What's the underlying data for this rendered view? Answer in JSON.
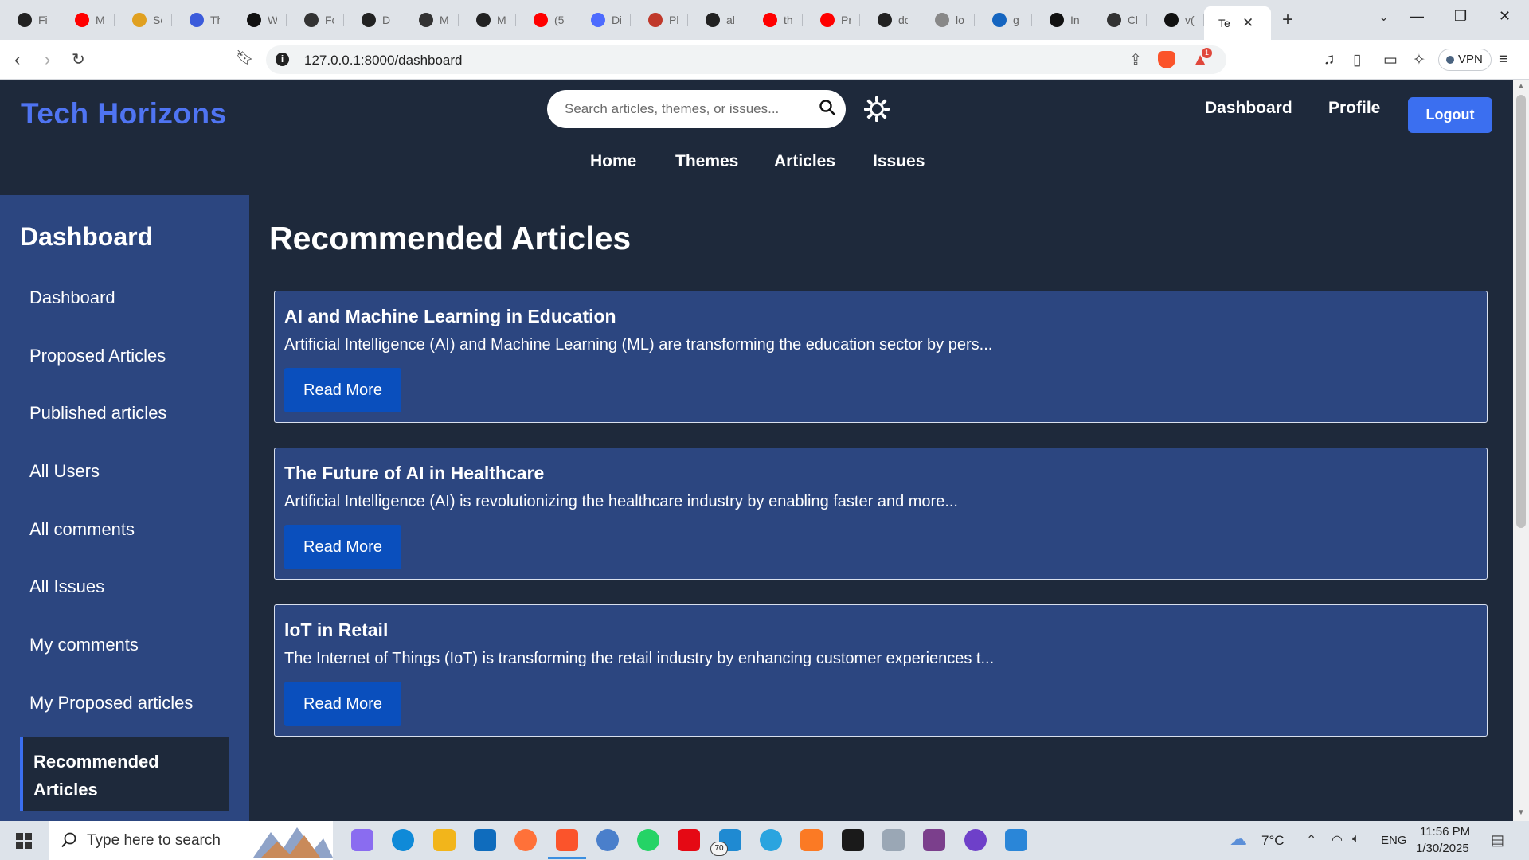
{
  "browser": {
    "tabs": [
      {
        "label": "Fi",
        "icon": "github-icon",
        "color": "#222222"
      },
      {
        "label": "M",
        "icon": "youtube-icon",
        "color": "#ff0000"
      },
      {
        "label": "Sc",
        "icon": "leaf-icon",
        "color": "#e0a020"
      },
      {
        "label": "Th",
        "icon": "power-icon",
        "color": "#3b5bdb"
      },
      {
        "label": "W",
        "icon": "medium-icon",
        "color": "#111111"
      },
      {
        "label": "Fc",
        "icon": "openai-icon",
        "color": "#333333"
      },
      {
        "label": "D",
        "icon": "github-icon",
        "color": "#222222"
      },
      {
        "label": "M",
        "icon": "profile-card-icon",
        "color": "#333333"
      },
      {
        "label": "M",
        "icon": "github-icon",
        "color": "#222222"
      },
      {
        "label": "(5",
        "icon": "youtube-icon",
        "color": "#ff0000"
      },
      {
        "label": "Di",
        "icon": "deepseek-icon",
        "color": "#4d6bfe"
      },
      {
        "label": "Pl",
        "icon": "playlist-icon",
        "color": "#c0392b"
      },
      {
        "label": "al",
        "icon": "github-icon",
        "color": "#222222"
      },
      {
        "label": "th",
        "icon": "youtube-icon",
        "color": "#ff0000"
      },
      {
        "label": "Pr",
        "icon": "youtube-icon",
        "color": "#ff0000"
      },
      {
        "label": "dc",
        "icon": "github-icon",
        "color": "#222222"
      },
      {
        "label": "lo",
        "icon": "mountain-icon",
        "color": "#888888"
      },
      {
        "label": "g",
        "icon": "w-logo-icon",
        "color": "#1565c0"
      },
      {
        "label": "In",
        "icon": "openai-icon",
        "color": "#111111"
      },
      {
        "label": "Cl",
        "icon": "openai-icon",
        "color": "#333333"
      },
      {
        "label": "v(",
        "icon": "v0-icon",
        "color": "#111111"
      }
    ],
    "active_tab": {
      "label": "Te"
    },
    "url": "127.0.0.1:8000/dashboard",
    "vpn_label": "VPN",
    "rewards_badge": "1"
  },
  "header": {
    "brand": "Tech Horizons",
    "search_placeholder": "Search articles, themes, or issues...",
    "top_links": {
      "dashboard": "Dashboard",
      "profile": "Profile"
    },
    "logout_label": "Logout",
    "nav": {
      "home": "Home",
      "themes": "Themes",
      "articles": "Articles",
      "issues": "Issues"
    }
  },
  "sidebar": {
    "title": "Dashboard",
    "items": [
      {
        "label": "Dashboard"
      },
      {
        "label": "Proposed Articles"
      },
      {
        "label": "Published articles"
      },
      {
        "label": "All Users"
      },
      {
        "label": "All comments"
      },
      {
        "label": "All Issues"
      },
      {
        "label": "My comments"
      },
      {
        "label": "My Proposed articles"
      }
    ],
    "active_line1": "Recommended",
    "active_line2": "Articles"
  },
  "main": {
    "title": "Recommended Articles",
    "articles": [
      {
        "title": "AI and Machine Learning in Education",
        "excerpt": "Artificial Intelligence (AI) and Machine Learning (ML) are transforming the education sector by pers...",
        "button": "Read More"
      },
      {
        "title": "The Future of AI in Healthcare",
        "excerpt": "Artificial Intelligence (AI) is revolutionizing the healthcare industry by enabling faster and more...",
        "button": "Read More"
      },
      {
        "title": "IoT in Retail",
        "excerpt": "The Internet of Things (IoT) is transforming the retail industry by enhancing customer experiences t...",
        "button": "Read More"
      }
    ]
  },
  "taskbar": {
    "search_text": "Type here to search",
    "apps": [
      {
        "name": "copilot-icon",
        "color": "#8a6cf0"
      },
      {
        "name": "edge-icon",
        "color": "#0f8ad8"
      },
      {
        "name": "file-explorer-icon",
        "color": "#f2b51b"
      },
      {
        "name": "outlook-icon",
        "color": "#0f6cbd"
      },
      {
        "name": "firefox-icon",
        "color": "#ff7139"
      },
      {
        "name": "brave-icon",
        "color": "#fb542b"
      },
      {
        "name": "qbittorrent-icon",
        "color": "#4a7fcb"
      },
      {
        "name": "whatsapp-icon",
        "color": "#25d366"
      },
      {
        "name": "netflix-icon",
        "color": "#e50914"
      },
      {
        "name": "vscode-icon",
        "color": "#1f8ad2"
      },
      {
        "name": "telegram-icon",
        "color": "#2aa4df"
      },
      {
        "name": "xampp-icon",
        "color": "#fb7a24"
      },
      {
        "name": "terminal-icon",
        "color": "#1a1a1a"
      },
      {
        "name": "photos-icon",
        "color": "#9aa7b5"
      },
      {
        "name": "winrar-icon",
        "color": "#7b3f8c"
      },
      {
        "name": "github-desktop-icon",
        "color": "#6e40c9"
      },
      {
        "name": "paint-icon",
        "color": "#2a86d8"
      }
    ],
    "whatsapp_badge": "70",
    "weather": "7°C",
    "language": "ENG",
    "time": "11:56 PM",
    "date": "1/30/2025"
  }
}
